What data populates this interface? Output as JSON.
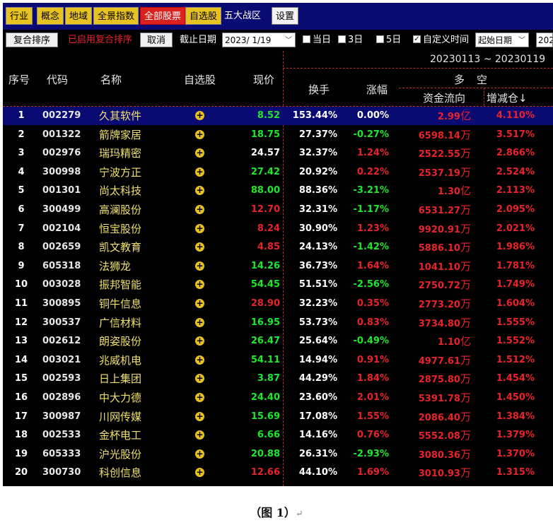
{
  "topbar": {
    "buttons": [
      "行业",
      "概念",
      "地域",
      "全景指数",
      "全部股票",
      "自选股",
      "五大战区",
      "设置"
    ]
  },
  "toolbar": {
    "compound_sort": "复合排序",
    "enabled_text": "已启用复合排序",
    "cancel": "取消",
    "cutoff_label": "截止日期",
    "cutoff_date": "2023/ 1/19",
    "opt_today": "当日",
    "opt_3day": "3日",
    "opt_5day": "5日",
    "opt_custom": "自定义时间",
    "start_date_label": "起始日期",
    "end_date_partial": "202"
  },
  "header": {
    "date_range": "20230113 ~ 20230119",
    "idx": "序号",
    "code": "代码",
    "name": "名称",
    "watch": "自选股",
    "price": "现价",
    "turnover": "换手",
    "change": "涨幅",
    "long": "多",
    "short": "空",
    "capital_flow": "资金流向",
    "inc_position": "增减仓↓"
  },
  "colors": {
    "up": "#e8232a",
    "down": "#1ee82a",
    "flat": "#ffffff",
    "name": "#f0e06a",
    "selected_bg": "#0a0a73"
  },
  "rows": [
    {
      "idx": "1",
      "code": "002279",
      "name": "久其软件",
      "price": "8.52",
      "turnover": "153.44%",
      "change": "0.00%",
      "flow": "2.99",
      "unit": "亿",
      "inc": "4.110%",
      "dir": "flat",
      "pcol": "down"
    },
    {
      "idx": "2",
      "code": "001322",
      "name": "箭牌家居",
      "price": "18.75",
      "turnover": "27.37%",
      "change": "-0.27%",
      "flow": "6598.14",
      "unit": "万",
      "inc": "3.517%",
      "dir": "down",
      "pcol": "down"
    },
    {
      "idx": "3",
      "code": "002976",
      "name": "瑞玛精密",
      "price": "24.57",
      "turnover": "32.37%",
      "change": "1.24%",
      "flow": "2522.55",
      "unit": "万",
      "inc": "2.866%",
      "dir": "up",
      "pcol": "flat"
    },
    {
      "idx": "4",
      "code": "300998",
      "name": "宁波方正",
      "price": "27.42",
      "turnover": "20.92%",
      "change": "0.22%",
      "flow": "2537.19",
      "unit": "万",
      "inc": "2.524%",
      "dir": "up",
      "pcol": "down"
    },
    {
      "idx": "5",
      "code": "001301",
      "name": "尚太科技",
      "price": "88.00",
      "turnover": "88.36%",
      "change": "-3.21%",
      "flow": "1.30",
      "unit": "亿",
      "inc": "2.113%",
      "dir": "down",
      "pcol": "down"
    },
    {
      "idx": "6",
      "code": "300499",
      "name": "高澜股份",
      "price": "12.70",
      "turnover": "32.31%",
      "change": "-1.17%",
      "flow": "6531.27",
      "unit": "万",
      "inc": "2.095%",
      "dir": "down",
      "pcol": "up"
    },
    {
      "idx": "7",
      "code": "002104",
      "name": "恒宝股份",
      "price": "8.24",
      "turnover": "30.90%",
      "change": "1.23%",
      "flow": "9920.91",
      "unit": "万",
      "inc": "2.021%",
      "dir": "up",
      "pcol": "up"
    },
    {
      "idx": "8",
      "code": "002659",
      "name": "凯文教育",
      "price": "4.85",
      "turnover": "24.13%",
      "change": "-1.42%",
      "flow": "5886.10",
      "unit": "万",
      "inc": "1.986%",
      "dir": "down",
      "pcol": "up"
    },
    {
      "idx": "9",
      "code": "605318",
      "name": "法狮龙",
      "price": "14.26",
      "turnover": "36.73%",
      "change": "1.64%",
      "flow": "1041.10",
      "unit": "万",
      "inc": "1.781%",
      "dir": "up",
      "pcol": "down"
    },
    {
      "idx": "10",
      "code": "003028",
      "name": "振邦智能",
      "price": "54.45",
      "turnover": "51.51%",
      "change": "-2.56%",
      "flow": "2750.72",
      "unit": "万",
      "inc": "1.749%",
      "dir": "down",
      "pcol": "down"
    },
    {
      "idx": "11",
      "code": "300895",
      "name": "铜牛信息",
      "price": "28.90",
      "turnover": "32.23%",
      "change": "0.35%",
      "flow": "2773.20",
      "unit": "万",
      "inc": "1.604%",
      "dir": "up",
      "pcol": "up"
    },
    {
      "idx": "12",
      "code": "300537",
      "name": "广信材料",
      "price": "16.95",
      "turnover": "53.73%",
      "change": "0.83%",
      "flow": "3734.80",
      "unit": "万",
      "inc": "1.555%",
      "dir": "up",
      "pcol": "down"
    },
    {
      "idx": "13",
      "code": "002612",
      "name": "朗姿股份",
      "price": "26.47",
      "turnover": "25.64%",
      "change": "-0.49%",
      "flow": "1.10",
      "unit": "亿",
      "inc": "1.552%",
      "dir": "down",
      "pcol": "down"
    },
    {
      "idx": "14",
      "code": "003021",
      "name": "兆威机电",
      "price": "54.11",
      "turnover": "14.94%",
      "change": "0.91%",
      "flow": "4977.61",
      "unit": "万",
      "inc": "1.512%",
      "dir": "up",
      "pcol": "down"
    },
    {
      "idx": "15",
      "code": "002593",
      "name": "日上集团",
      "price": "3.87",
      "turnover": "44.29%",
      "change": "1.84%",
      "flow": "2875.80",
      "unit": "万",
      "inc": "1.454%",
      "dir": "up",
      "pcol": "down"
    },
    {
      "idx": "16",
      "code": "002896",
      "name": "中大力德",
      "price": "24.40",
      "turnover": "23.60%",
      "change": "2.01%",
      "flow": "5391.78",
      "unit": "万",
      "inc": "1.450%",
      "dir": "up",
      "pcol": "down"
    },
    {
      "idx": "17",
      "code": "300987",
      "name": "川网传媒",
      "price": "15.69",
      "turnover": "17.08%",
      "change": "1.55%",
      "flow": "2086.40",
      "unit": "万",
      "inc": "1.384%",
      "dir": "up",
      "pcol": "down"
    },
    {
      "idx": "18",
      "code": "002533",
      "name": "金杯电工",
      "price": "6.66",
      "turnover": "14.16%",
      "change": "0.76%",
      "flow": "5552.08",
      "unit": "万",
      "inc": "1.379%",
      "dir": "up",
      "pcol": "down"
    },
    {
      "idx": "19",
      "code": "605333",
      "name": "沪光股份",
      "price": "20.88",
      "turnover": "26.31%",
      "change": "-2.93%",
      "flow": "3080.36",
      "unit": "万",
      "inc": "1.370%",
      "dir": "down",
      "pcol": "down"
    },
    {
      "idx": "20",
      "code": "300730",
      "name": "科创信息",
      "price": "12.66",
      "turnover": "44.10%",
      "change": "1.69%",
      "flow": "3010.93",
      "unit": "万",
      "inc": "1.315%",
      "dir": "up",
      "pcol": "up"
    }
  ],
  "caption": {
    "text": "（图 1）",
    "return_mark": "↵"
  }
}
